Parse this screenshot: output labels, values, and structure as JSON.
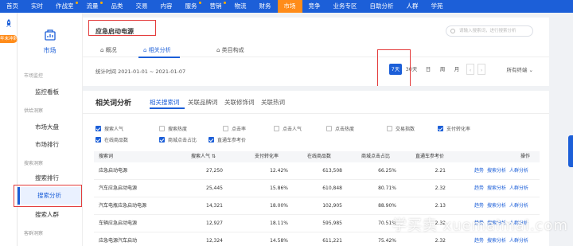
{
  "nav": {
    "items": [
      {
        "label": "首页",
        "dot": false,
        "active": false
      },
      {
        "label": "实时",
        "dot": false,
        "active": false
      },
      {
        "label": "作战室",
        "dot": true,
        "active": false
      },
      {
        "label": "流量",
        "dot": true,
        "active": false
      },
      {
        "label": "品类",
        "dot": false,
        "active": false
      },
      {
        "label": "交易",
        "dot": false,
        "active": false
      },
      {
        "label": "内容",
        "dot": false,
        "active": false
      },
      {
        "label": "服务",
        "dot": true,
        "active": false
      },
      {
        "label": "营销",
        "dot": true,
        "active": false
      },
      {
        "label": "物流",
        "dot": false,
        "active": false
      },
      {
        "label": "财务",
        "dot": false,
        "active": false
      },
      {
        "label": "市场",
        "dot": false,
        "active": true
      },
      {
        "label": "竞争",
        "dot": false,
        "active": false
      },
      {
        "label": "业务专区",
        "dot": false,
        "active": false
      },
      {
        "label": "自助分析",
        "dot": false,
        "active": false
      },
      {
        "label": "人群",
        "dot": false,
        "active": false
      },
      {
        "label": "学苑",
        "dot": false,
        "active": false
      }
    ]
  },
  "rail": {
    "badge": "年末冲刺"
  },
  "sidebar": {
    "category_label": "市场",
    "groups": [
      {
        "title": "市场监控",
        "links": [
          "监控看板"
        ]
      },
      {
        "title": "供给洞察",
        "links": [
          "市场大盘",
          "市场排行"
        ]
      },
      {
        "title": "搜索洞察",
        "links": [
          "搜索排行",
          "搜索分析",
          "搜索人群"
        ]
      },
      {
        "title": "客群洞察",
        "links": []
      }
    ],
    "active_link": "搜索分析"
  },
  "page": {
    "keyword": "应急启动电源",
    "search_placeholder": "请输入搜索词，进行搜索分析",
    "tabs": [
      "概况",
      "相关分析",
      "类目构成"
    ],
    "date_range": "统计时间 2021-01-01 ~ 2021-01-07",
    "date_buttons": [
      "7天",
      "30天",
      "日",
      "周",
      "月"
    ],
    "date_arrows": [
      "‹",
      "›"
    ],
    "terminal": "所有终端"
  },
  "analysis": {
    "title": "相关词分析",
    "tabs": [
      "相关搜索词",
      "关联品牌词",
      "关联修饰词",
      "关联热词"
    ],
    "metrics": [
      {
        "label": "搜索人气",
        "checked": true
      },
      {
        "label": "搜索热度",
        "checked": false
      },
      {
        "label": "点击率",
        "checked": false
      },
      {
        "label": "点击人气",
        "checked": false
      },
      {
        "label": "点击热度",
        "checked": false
      },
      {
        "label": "交易指数",
        "checked": false
      },
      {
        "label": "支付转化率",
        "checked": true
      },
      {
        "label": "在线商品数",
        "checked": true
      },
      {
        "label": "商城点击占比",
        "checked": true
      },
      {
        "label": "直通车参考价",
        "checked": true
      }
    ],
    "columns": [
      "搜索词",
      "搜索人气",
      "支付转化率",
      "在线商品数",
      "商城点击占比",
      "直通车参考价",
      "操作"
    ],
    "sort_indicator": "⇅",
    "rows": [
      {
        "word": "应急启动电源",
        "popularity": "27,250",
        "conversion": "12.42%",
        "items": "613,508",
        "mall_click": "66.25%",
        "ztc_price": "2.21",
        "ops": [
          "趋势",
          "搜索分析",
          "人群分析"
        ]
      },
      {
        "word": "汽车应急启动电源",
        "popularity": "25,445",
        "conversion": "15.86%",
        "items": "610,848",
        "mall_click": "80.71%",
        "ztc_price": "2.32",
        "ops": [
          "趋势",
          "搜索分析",
          "人群分析"
        ]
      },
      {
        "word": "汽车电瓶应急启动电源",
        "popularity": "14,321",
        "conversion": "18.00%",
        "items": "102,905",
        "mall_click": "88.90%",
        "ztc_price": "2.13",
        "ops": [
          "趋势",
          "搜索分析",
          "人群分析"
        ]
      },
      {
        "word": "车辆应急启动电源",
        "popularity": "12,927",
        "conversion": "18.11%",
        "items": "595,985",
        "mall_click": "70.51%",
        "ztc_price": "2.32",
        "ops": [
          "趋势",
          "搜索分析",
          "人群分析"
        ]
      },
      {
        "word": "应急电源汽车启动",
        "popularity": "12,324",
        "conversion": "14.58%",
        "items": "611,221",
        "mall_click": "75.42%",
        "ztc_price": "2.32",
        "ops": [
          "趋势",
          "搜索分析",
          "人群分析"
        ]
      }
    ]
  },
  "watermark": "学买卖 xuemaimai.com",
  "colors": {
    "primary": "#1c5fd8",
    "active_nav": "#ff8c1a",
    "highlight_box": "#e33b3b"
  }
}
